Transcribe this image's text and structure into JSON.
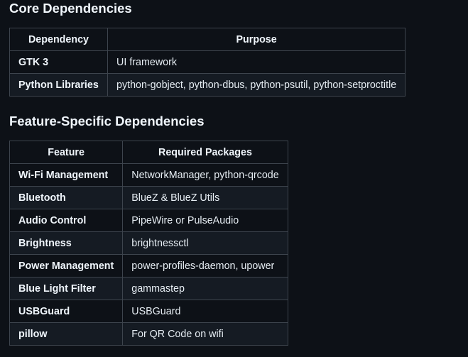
{
  "core": {
    "heading": "Core Dependencies",
    "headers": [
      "Dependency",
      "Purpose"
    ],
    "rows": [
      {
        "name": "GTK 3",
        "value": "UI framework"
      },
      {
        "name": "Python Libraries",
        "value": "python-gobject, python-dbus, python-psutil, python-setproctitle"
      }
    ]
  },
  "feature": {
    "heading": "Feature-Specific Dependencies",
    "headers": [
      "Feature",
      "Required Packages"
    ],
    "rows": [
      {
        "name": "Wi-Fi Management",
        "value": "NetworkManager, python-qrcode"
      },
      {
        "name": "Bluetooth",
        "value": "BlueZ & BlueZ Utils"
      },
      {
        "name": "Audio Control",
        "value": "PipeWire or PulseAudio"
      },
      {
        "name": "Brightness",
        "value": "brightnessctl"
      },
      {
        "name": "Power Management",
        "value": "power-profiles-daemon, upower"
      },
      {
        "name": "Blue Light Filter",
        "value": "gammastep"
      },
      {
        "name": "USBGuard",
        "value": "USBGuard"
      },
      {
        "name": "pillow",
        "value": "For QR Code on wifi"
      }
    ]
  }
}
